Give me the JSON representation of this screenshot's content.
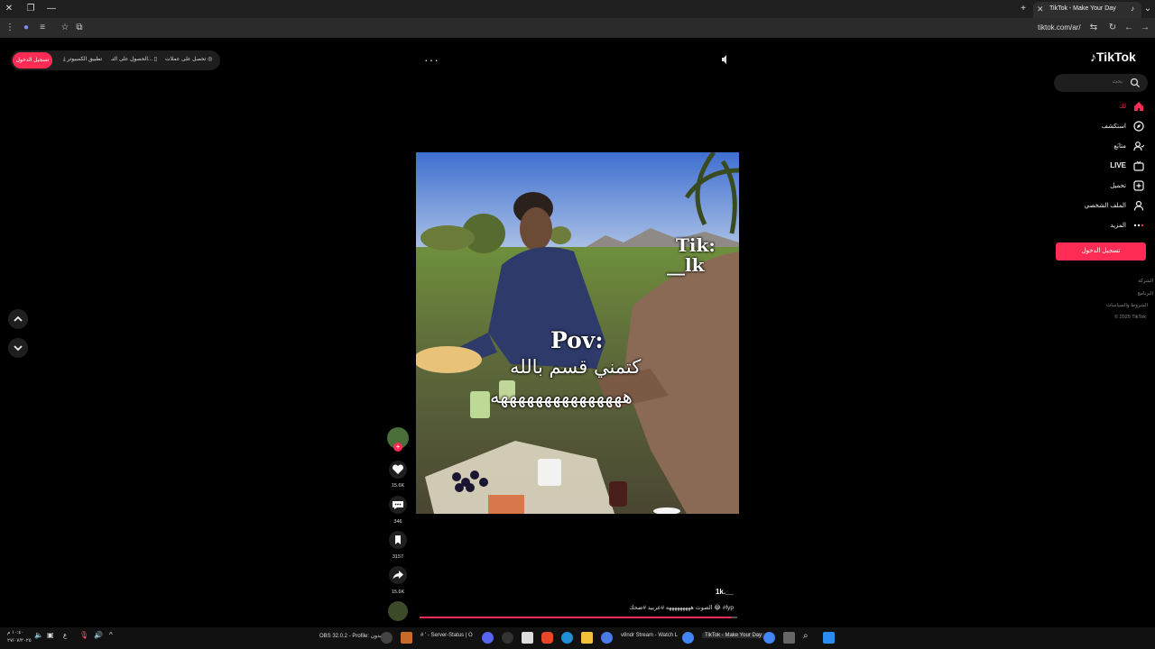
{
  "browser": {
    "active_tab_title": "TikTok - Make Your Day",
    "url": "tiktok.com/ar/"
  },
  "top_promo": {
    "login": "تسجيل الدخول",
    "desktop_app": "تطبيق الكمبيوتر",
    "get_app": "الحصول على التـ...",
    "coins": "تحصل على عملات"
  },
  "sidebar": {
    "logo": "TikTok",
    "search_placeholder": "بحث",
    "items": [
      {
        "label": "لك",
        "icon": "home-icon"
      },
      {
        "label": "استكشف",
        "icon": "compass-icon"
      },
      {
        "label": "متابَع",
        "icon": "following-icon"
      },
      {
        "label": "LIVE",
        "icon": "live-icon"
      },
      {
        "label": "تحميل",
        "icon": "upload-icon"
      },
      {
        "label": "الملف الشخصي",
        "icon": "profile-icon"
      },
      {
        "label": "المزيد",
        "icon": "more-icon"
      }
    ],
    "login_button": "تسجيل الدخول",
    "footer": [
      "الشركة",
      "البرنامج",
      "الشروط والسياسات",
      "© 2025 TikTok"
    ]
  },
  "video": {
    "overlay_top": "Tik:",
    "overlay_top2": "__lk",
    "overlay_title": "Pov:",
    "overlay_line1": "كتمني قسم بالله",
    "overlay_line2": "هههههههههههههههه"
  },
  "actions": {
    "likes": "15.6K",
    "comments": "346",
    "saves": "3157",
    "shares": "15.6K"
  },
  "caption": {
    "username": "1k.__",
    "text": "الصوت هههههههههه #عربيد #ضحك 😂 #fyp"
  },
  "progress": 0.98,
  "taskbar": {
    "obs": "OBS 32.0.2 - Profile: بدون",
    "server_status": "# ' - Server-Status | O",
    "stream": "v8ndr Stream - Watch L",
    "tiktok": "TikTok - Make Your Day",
    "time": "١٠:٤٠ م",
    "date": "٢٧/٠٧/٢٠٢٥",
    "lang": "ع"
  }
}
